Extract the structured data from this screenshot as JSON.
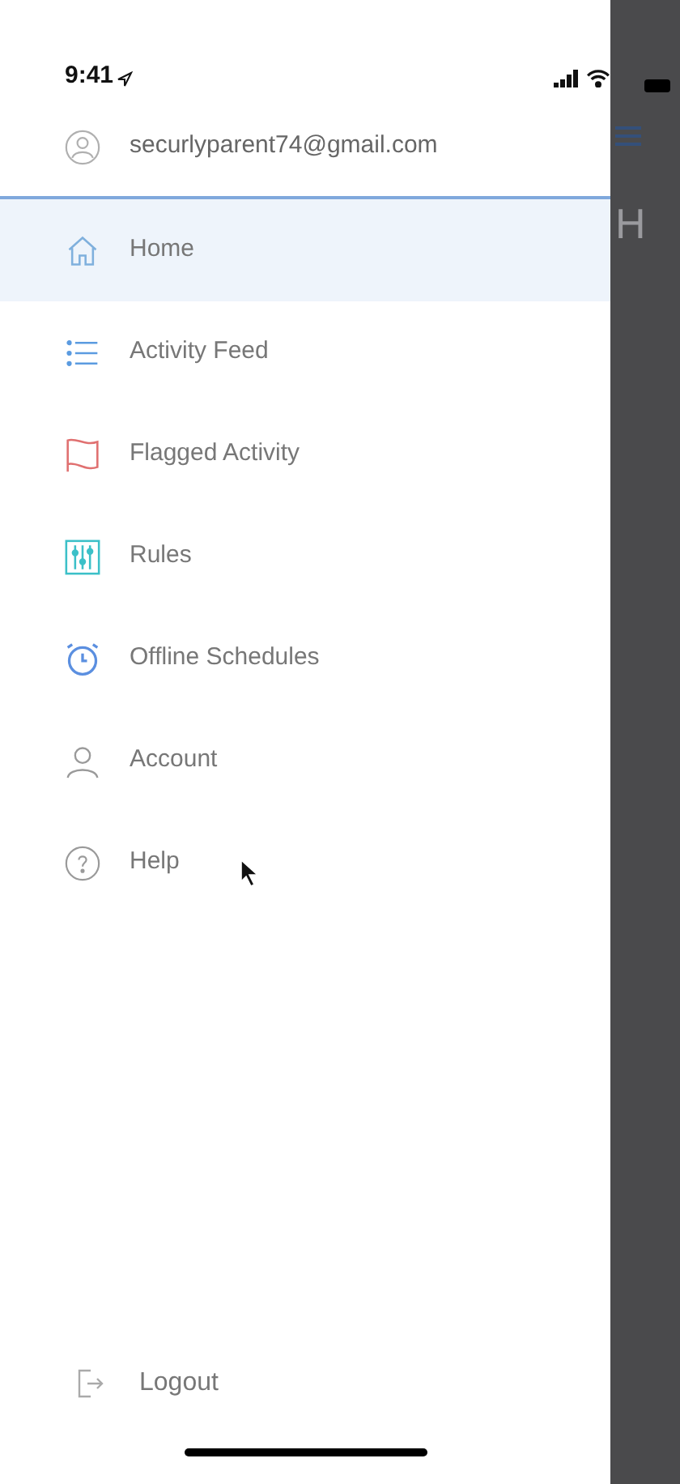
{
  "status_bar": {
    "time": "9:41"
  },
  "drawer": {
    "account": {
      "email": "securlyparent74@gmail.com"
    },
    "items": [
      {
        "label": "Home",
        "kind": "home",
        "selected": true
      },
      {
        "label": "Activity Feed",
        "kind": "list",
        "selected": false
      },
      {
        "label": "Flagged Activity",
        "kind": "flag",
        "selected": false
      },
      {
        "label": "Rules",
        "kind": "sliders",
        "selected": false
      },
      {
        "label": "Offline Schedules",
        "kind": "alarm",
        "selected": false
      },
      {
        "label": "Account",
        "kind": "user",
        "selected": false
      },
      {
        "label": "Help",
        "kind": "help",
        "selected": false
      }
    ],
    "logout": {
      "label": "Logout"
    }
  },
  "background_screen": {
    "title": "H"
  }
}
